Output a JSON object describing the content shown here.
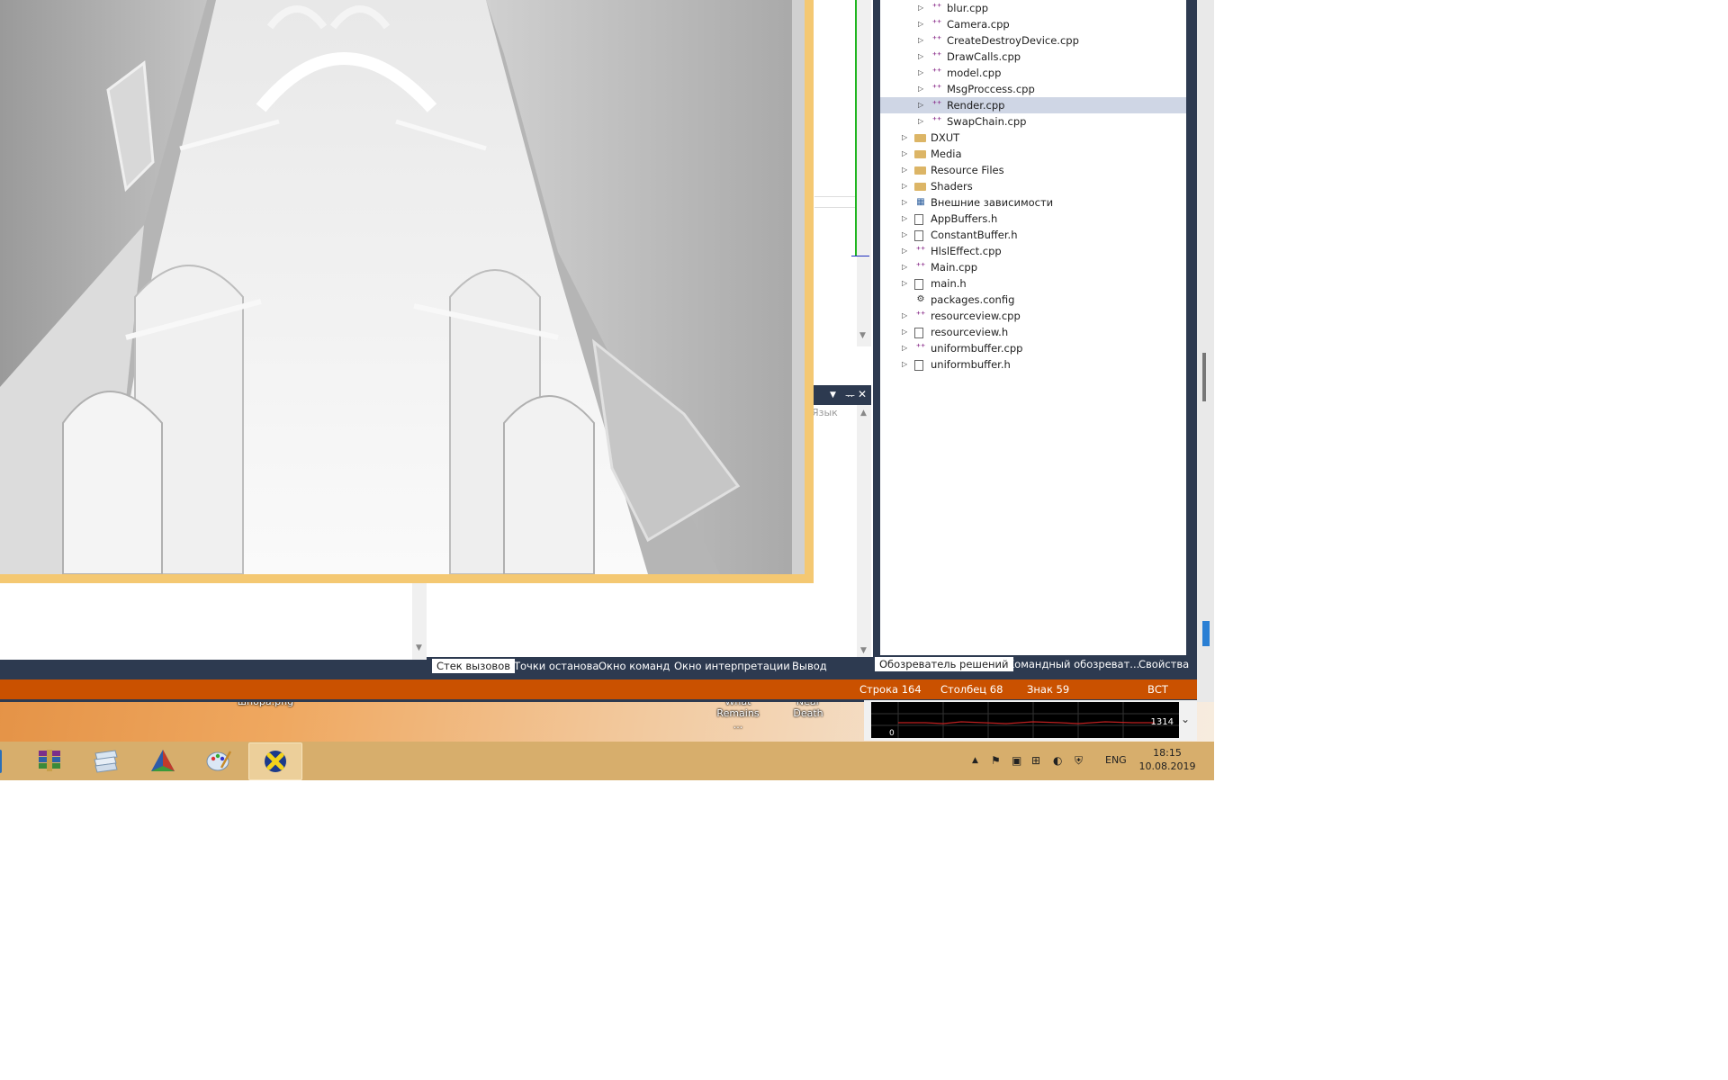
{
  "desktop": {
    "icons": [
      {
        "label": "шпора.png"
      },
      {
        "label": "What Remains ..."
      },
      {
        "label": "Near Death"
      }
    ]
  },
  "solution_explorer": {
    "items": [
      {
        "label": "blur.cpp",
        "type": "cpp",
        "level": 2
      },
      {
        "label": "Camera.cpp",
        "type": "cpp",
        "level": 2
      },
      {
        "label": "CreateDestroyDevice.cpp",
        "type": "cpp",
        "level": 2
      },
      {
        "label": "DrawCalls.cpp",
        "type": "cpp",
        "level": 2
      },
      {
        "label": "model.cpp",
        "type": "cpp",
        "level": 2
      },
      {
        "label": "MsgProccess.cpp",
        "type": "cpp",
        "level": 2
      },
      {
        "label": "Render.cpp",
        "type": "cpp",
        "level": 2,
        "selected": true
      },
      {
        "label": "SwapChain.cpp",
        "type": "cpp",
        "level": 2
      },
      {
        "label": "DXUT",
        "type": "folder",
        "level": 1
      },
      {
        "label": "Media",
        "type": "folder",
        "level": 1
      },
      {
        "label": "Resource Files",
        "type": "folder",
        "level": 1
      },
      {
        "label": "Shaders",
        "type": "folder",
        "level": 1
      },
      {
        "label": "Внешние зависимости",
        "type": "ref",
        "level": 1
      },
      {
        "label": "AppBuffers.h",
        "type": "h",
        "level": 1
      },
      {
        "label": "ConstantBuffer.h",
        "type": "h",
        "level": 1
      },
      {
        "label": "HlslEffect.cpp",
        "type": "cpp",
        "level": 1
      },
      {
        "label": "Main.cpp",
        "type": "cpp",
        "level": 1
      },
      {
        "label": "main.h",
        "type": "h",
        "level": 1
      },
      {
        "label": "packages.config",
        "type": "cfg",
        "level": 1
      },
      {
        "label": "resourceview.cpp",
        "type": "cpp",
        "level": 1
      },
      {
        "label": "resourceview.h",
        "type": "h",
        "level": 1
      },
      {
        "label": "uniformbuffer.cpp",
        "type": "cpp",
        "level": 1
      },
      {
        "label": "uniformbuffer.h",
        "type": "h",
        "level": 1
      }
    ],
    "tabs": [
      {
        "label": "Обозреватель решений",
        "active": true
      },
      {
        "label": "Командный обозреват...",
        "active": false
      },
      {
        "label": "Свойства",
        "active": false
      }
    ]
  },
  "debug_tabs": [
    {
      "label": "Стек вызовов",
      "active": true
    },
    {
      "label": "Точки останова",
      "active": false
    },
    {
      "label": "Окно команд",
      "active": false
    },
    {
      "label": "Окно интерпретации",
      "active": false
    },
    {
      "label": "Вывод",
      "active": false
    }
  ],
  "mid_pane": {
    "column_header": "Язык"
  },
  "status_bar": {
    "line": "Строка 164",
    "column": "Столбец 68",
    "char": "Знак 59",
    "mode": "ВСТ"
  },
  "perf_widget": {
    "value": "1314",
    "zero": "0"
  },
  "taskbar": {
    "apps": [
      {
        "icon": "winrar-icon"
      },
      {
        "icon": "stack-app-icon"
      },
      {
        "icon": "triangle-app-icon"
      },
      {
        "icon": "paint-palette-icon"
      },
      {
        "icon": "directx-app-icon",
        "active": true
      }
    ],
    "language": "ENG",
    "time": "18:15",
    "date": "10.08.2019"
  },
  "colors": {
    "vs_frame": "#2d3a50",
    "status_bar": "#ca5100",
    "render_border": "#f4c872",
    "taskbar": "#d7ae6c",
    "selection": "#cfd6e5"
  }
}
